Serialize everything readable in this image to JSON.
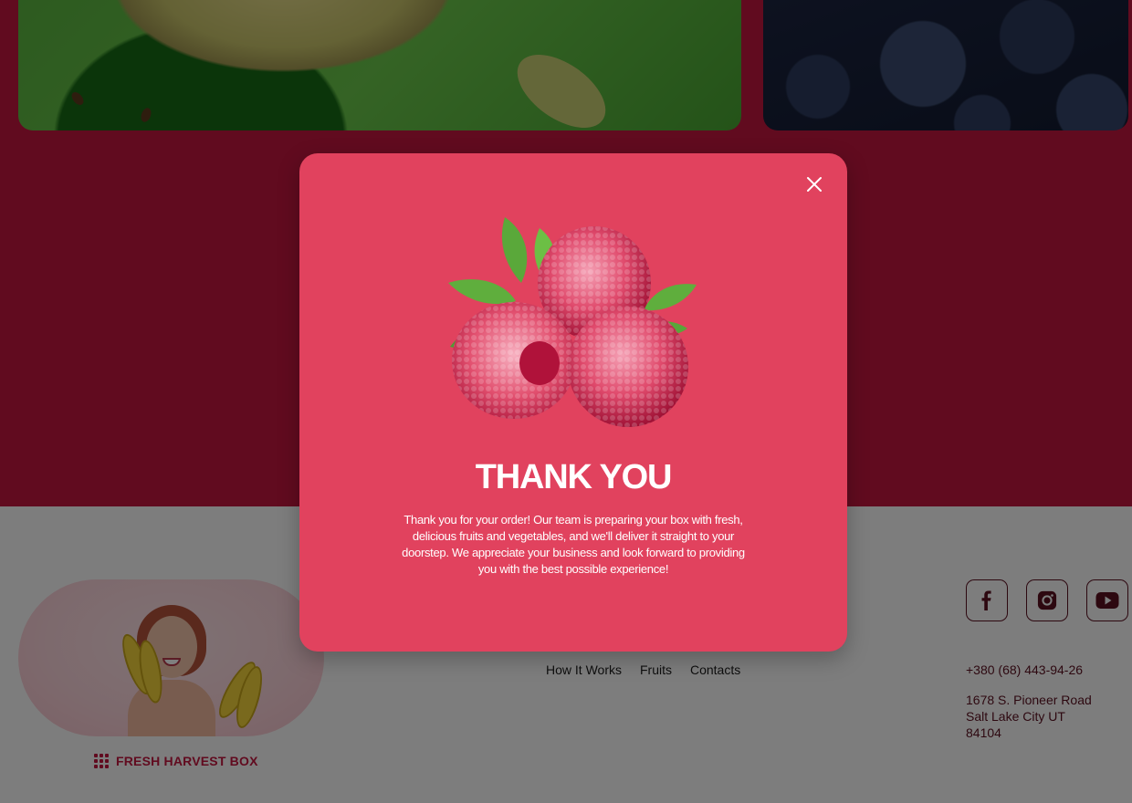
{
  "brand": {
    "name": "FRESH HARVEST BOX",
    "grid_icon": "grid-icon"
  },
  "footer_nav": [
    {
      "label": "How It Works"
    },
    {
      "label": "Fruits"
    },
    {
      "label": "Contacts"
    }
  ],
  "socials": [
    {
      "name": "facebook",
      "icon": "facebook-icon"
    },
    {
      "name": "instagram",
      "icon": "instagram-icon"
    },
    {
      "name": "youtube",
      "icon": "youtube-icon"
    }
  ],
  "contact": {
    "phone": "+380 (68) 443-94-26",
    "address_line1": "1678 S. Pioneer Road",
    "address_line2": "Salt Lake City UT",
    "address_line3": "84104"
  },
  "modal": {
    "title": "THANK YOU",
    "message": "Thank you for your order! Our team is preparing your box with fresh, delicious fruits and vegetables, and we'll deliver it straight to your doorstep. We appreciate your business and look forward to providing you with the best possible experience!",
    "close_icon": "close-icon",
    "image": "raspberries-image"
  },
  "colors": {
    "brand_red": "#c3163f",
    "modal_bg": "#e1425e",
    "dark_text": "#5a1020"
  }
}
